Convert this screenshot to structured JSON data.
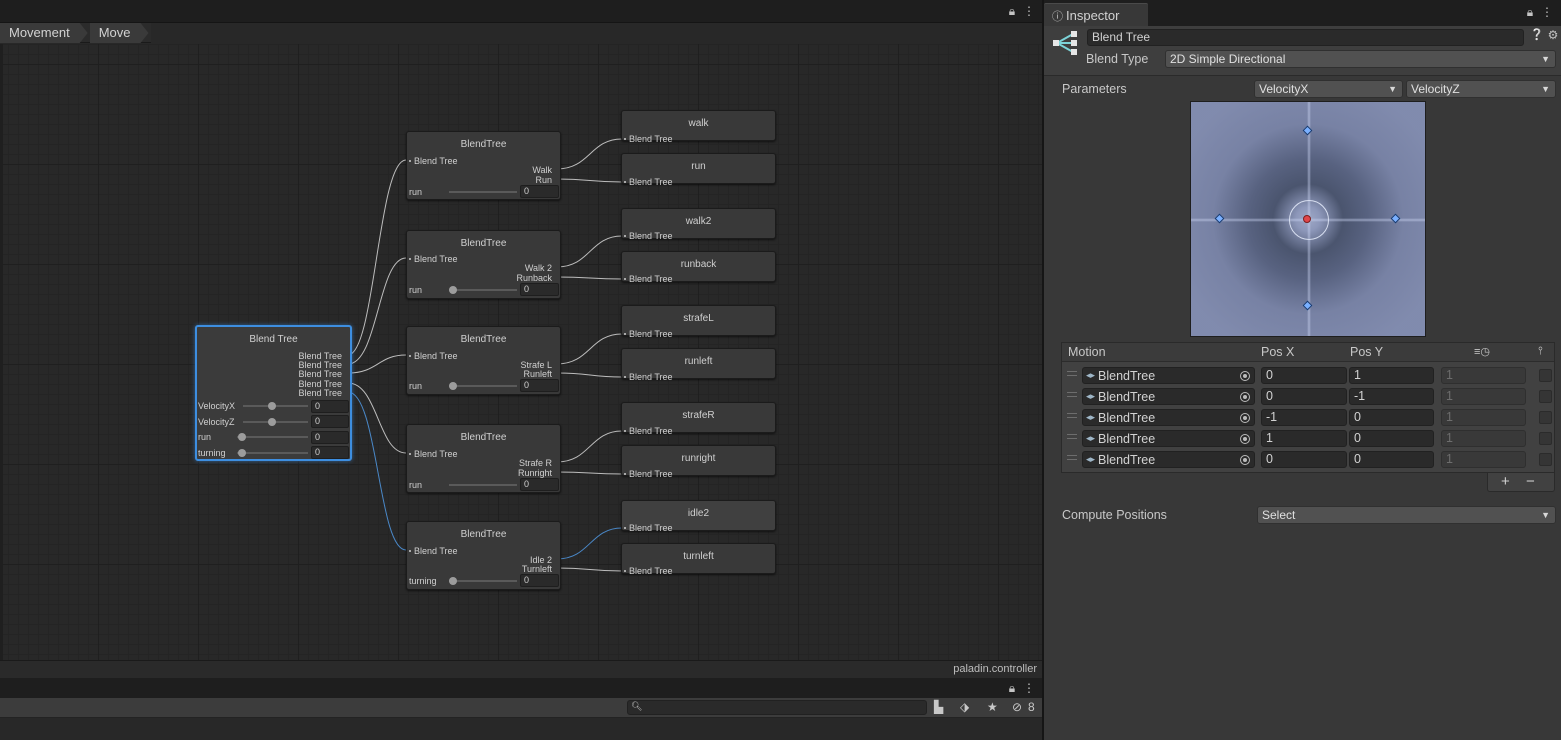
{
  "animator": {
    "breadcrumb": [
      "Movement",
      "Move"
    ],
    "controller_name": "paladin.controller",
    "root_node": {
      "title": "Blend Tree",
      "outputs": [
        "Blend Tree",
        "Blend Tree",
        "Blend Tree",
        "Blend Tree",
        "Blend Tree"
      ],
      "params": [
        {
          "name": "VelocityX",
          "value": "0"
        },
        {
          "name": "VelocityZ",
          "value": "0"
        },
        {
          "name": "run",
          "value": "0"
        },
        {
          "name": "turning",
          "value": "0"
        }
      ]
    },
    "sub_trees": [
      {
        "title": "BlendTree",
        "input": "Blend Tree",
        "outputs": [
          "Walk",
          "Run"
        ],
        "param": "run",
        "value": "0"
      },
      {
        "title": "BlendTree",
        "input": "Blend Tree",
        "outputs": [
          "Walk 2",
          "Runback"
        ],
        "param": "run",
        "value": "0"
      },
      {
        "title": "BlendTree",
        "input": "Blend Tree",
        "outputs": [
          "Strafe L",
          "Runleft"
        ],
        "param": "run",
        "value": "0"
      },
      {
        "title": "BlendTree",
        "input": "Blend Tree",
        "outputs": [
          "Strafe R",
          "Runright"
        ],
        "param": "run",
        "value": "0"
      },
      {
        "title": "BlendTree",
        "input": "Blend Tree",
        "outputs": [
          "Idle 2",
          "Turnleft"
        ],
        "param": "turning",
        "value": "0"
      }
    ],
    "clips": [
      {
        "title": "walk",
        "sub": "Blend Tree"
      },
      {
        "title": "run",
        "sub": "Blend Tree"
      },
      {
        "title": "walk2",
        "sub": "Blend Tree"
      },
      {
        "title": "runback",
        "sub": "Blend Tree"
      },
      {
        "title": "strafeL",
        "sub": "Blend Tree"
      },
      {
        "title": "runleft",
        "sub": "Blend Tree"
      },
      {
        "title": "strafeR",
        "sub": "Blend Tree"
      },
      {
        "title": "runright",
        "sub": "Blend Tree"
      },
      {
        "title": "idle2",
        "sub": "Blend Tree"
      },
      {
        "title": "turnleft",
        "sub": "Blend Tree"
      }
    ]
  },
  "console": {
    "search_placeholder": "",
    "hidden_count": "8"
  },
  "inspector": {
    "tab_label": "Inspector",
    "name": "Blend Tree",
    "blend_type_label": "Blend Type",
    "blend_type": "2D Simple Directional",
    "parameters_label": "Parameters",
    "param_x": "VelocityX",
    "param_y": "VelocityZ",
    "table_headers": {
      "motion": "Motion",
      "pos_x": "Pos X",
      "pos_y": "Pos Y"
    },
    "motions": [
      {
        "name": "BlendTree",
        "pos_x": "0",
        "pos_y": "1",
        "speed": "1"
      },
      {
        "name": "BlendTree",
        "pos_x": "0",
        "pos_y": "-1",
        "speed": "1"
      },
      {
        "name": "BlendTree",
        "pos_x": "-1",
        "pos_y": "0",
        "speed": "1"
      },
      {
        "name": "BlendTree",
        "pos_x": "1",
        "pos_y": "0",
        "speed": "1"
      },
      {
        "name": "BlendTree",
        "pos_x": "0",
        "pos_y": "0",
        "speed": "1"
      }
    ],
    "add_label": "+",
    "remove_label": "−",
    "compute_label": "Compute Positions",
    "compute_value": "Select"
  },
  "colors": {
    "selection": "#3d8ee0",
    "active_wire": "#4a88c8",
    "point": "#7ab0ff",
    "center": "#e0464a"
  },
  "icons": [
    "lock-icon",
    "menu-icon",
    "info-icon",
    "blend-tree-icon",
    "help-icon",
    "settings-icon",
    "search-icon",
    "filter-icon",
    "tag-icon",
    "star-icon",
    "hidden-icon",
    "target-icon"
  ]
}
